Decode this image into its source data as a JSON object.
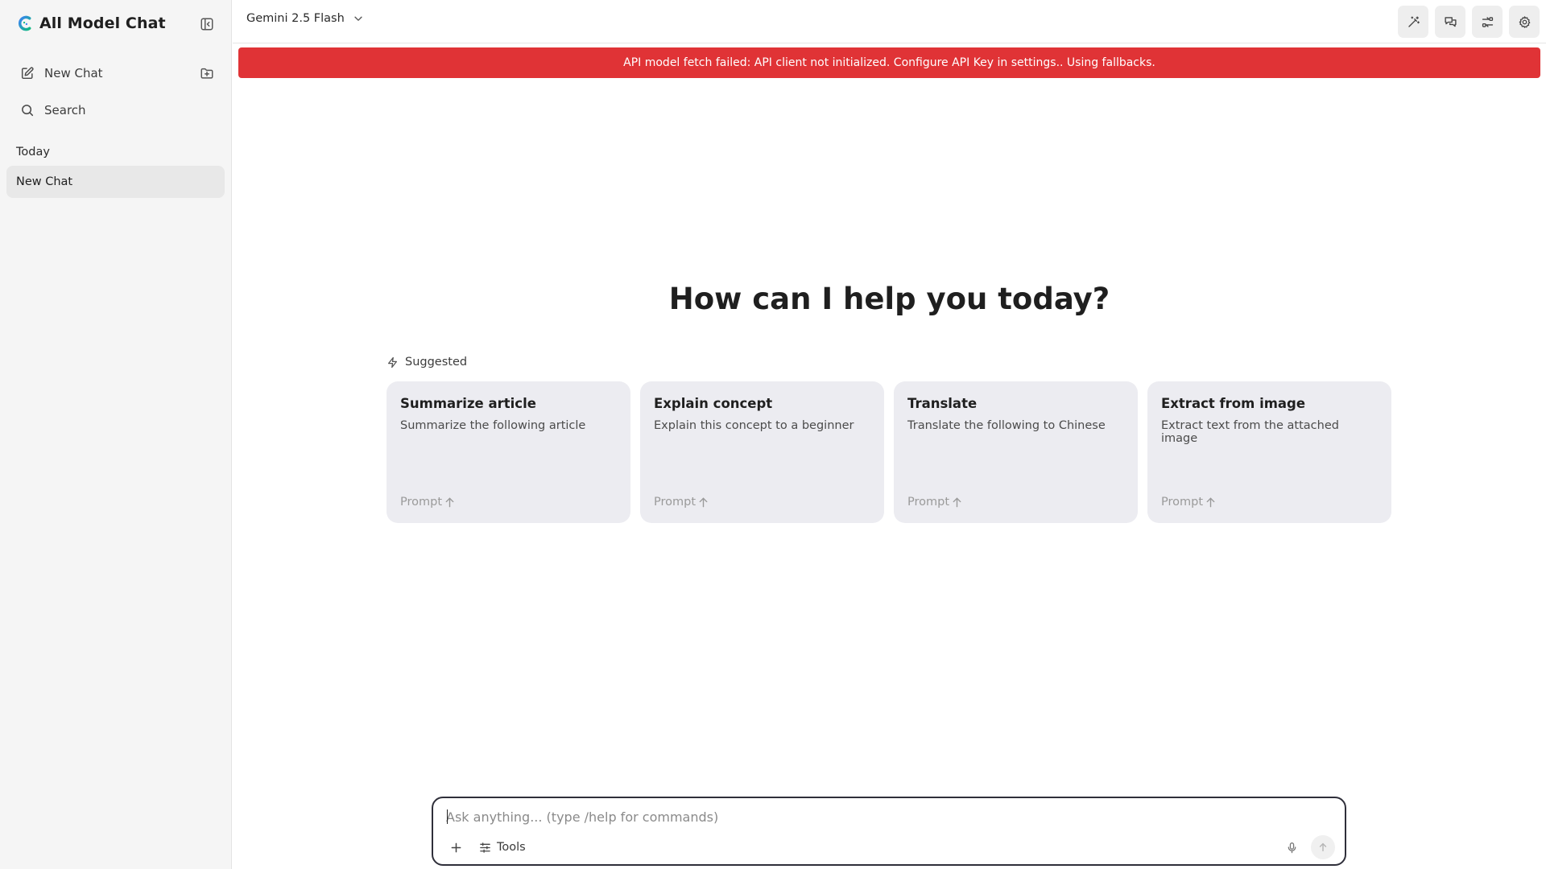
{
  "sidebar": {
    "app_title": "All Model Chat",
    "new_chat_label": "New Chat",
    "search_label": "Search",
    "section_today": "Today",
    "chats": [
      {
        "title": "New Chat",
        "active": true
      }
    ]
  },
  "header": {
    "model_name": "Gemini 2.5 Flash",
    "actions": [
      "magic-wand-icon",
      "chat-bubbles-icon",
      "switch-icon",
      "gear-icon"
    ]
  },
  "banner": {
    "message": "API model fetch failed: API client not initialized. Configure API Key in settings.. Using fallbacks.",
    "color": "#e03336"
  },
  "main": {
    "title": "How can I help you today?",
    "suggested_label": "Suggested",
    "cards": [
      {
        "title": "Summarize article",
        "description": "Summarize the following article",
        "footer": "Prompt"
      },
      {
        "title": "Explain concept",
        "description": "Explain this concept to a beginner",
        "footer": "Prompt"
      },
      {
        "title": "Translate",
        "description": "Translate the following to Chinese",
        "footer": "Prompt"
      },
      {
        "title": "Extract from image",
        "description": "Extract text from the attached image",
        "footer": "Prompt"
      }
    ]
  },
  "composer": {
    "placeholder": "Ask anything... (type /help for commands)",
    "value": "",
    "tools_label": "Tools"
  }
}
